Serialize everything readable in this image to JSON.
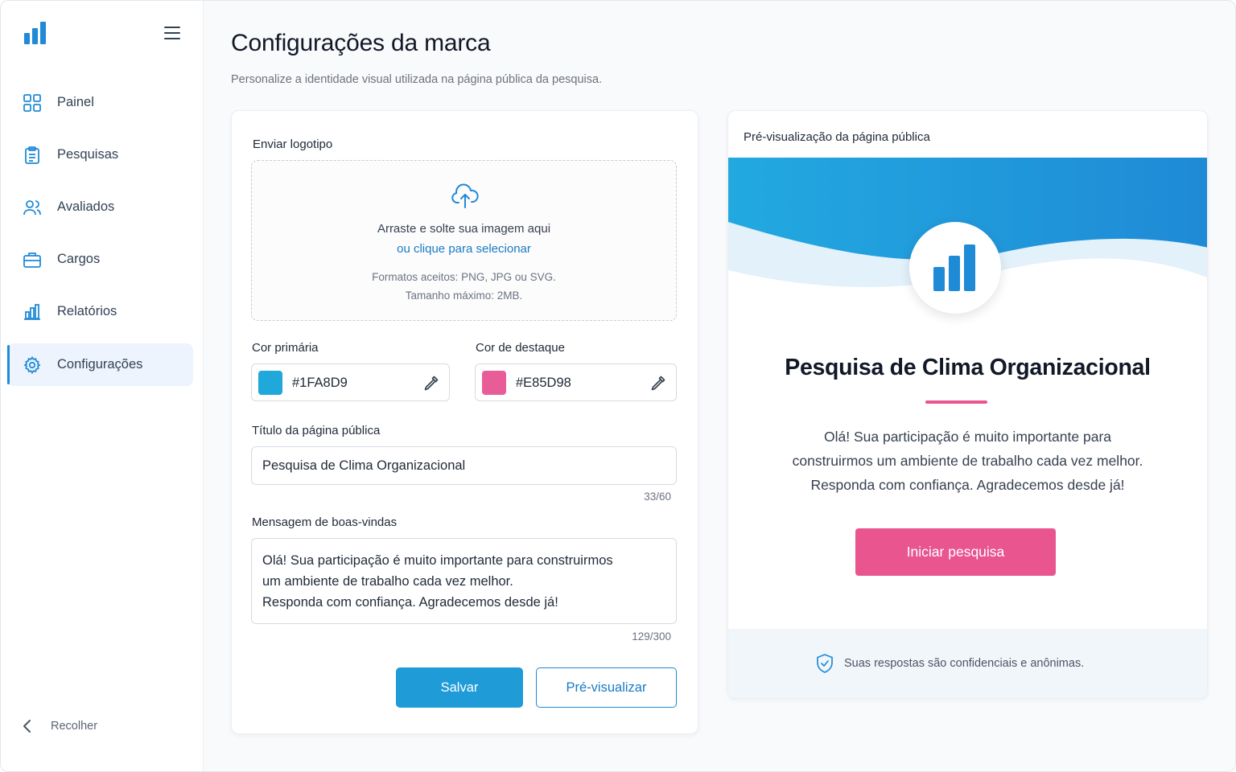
{
  "app": {
    "logo_icon": "bar-chart-logo",
    "menu_icon": "hamburger-icon"
  },
  "sidebar": {
    "items": [
      {
        "label": "Painel",
        "icon": "grid-icon",
        "active": false
      },
      {
        "label": "Pesquisas",
        "icon": "clipboard-icon",
        "active": false
      },
      {
        "label": "Avaliados",
        "icon": "users-icon",
        "active": false
      },
      {
        "label": "Cargos",
        "icon": "briefcase-icon",
        "active": false
      },
      {
        "label": "Relatórios",
        "icon": "bar-chart-icon",
        "active": false
      },
      {
        "label": "Configurações",
        "icon": "gear-icon",
        "active": true
      }
    ],
    "collapse_label": "Recolher"
  },
  "header": {
    "title": "Configurações da marca",
    "subtitle": "Personalize a identidade visual utilizada na página pública da pesquisa."
  },
  "form": {
    "logo_label": "Enviar logotipo",
    "dropzone": {
      "line1": "Arraste e solte sua imagem aqui",
      "link": "ou clique para selecionar",
      "formats": "Formatos aceitos: PNG, JPG ou SVG.",
      "max_size": "Tamanho máximo: 2MB."
    },
    "primary_color": {
      "label": "Cor primária",
      "value": "#1FA8D9",
      "swatch": "#1FA8D9"
    },
    "accent_color": {
      "label": "Cor de destaque",
      "value": "#E85D98",
      "swatch": "#E85D98"
    },
    "title_field": {
      "label": "Título da página pública",
      "value": "Pesquisa de Clima Organizacional",
      "counter": "33/60"
    },
    "message_field": {
      "label": "Mensagem de boas-vindas",
      "lines": [
        "Olá! Sua participação é muito importante para construirmos",
        "um ambiente de trabalho cada vez melhor.",
        "Responda com confiança. Agradecemos desde já!"
      ],
      "counter": "129/300"
    },
    "save_label": "Salvar",
    "preview_label": "Pré-visualizar"
  },
  "preview": {
    "label": "Pré-visualização da página pública",
    "title": "Pesquisa de Clima Organizacional",
    "message_lines": [
      "Olá! Sua participação é muito importante para",
      "construirmos um ambiente de trabalho cada vez melhor.",
      "Responda com confiança. Agradecemos desde já!"
    ],
    "start_button": "Iniciar pesquisa",
    "footer_text": "Suas respostas são confidenciais e anônimas.",
    "footer_icon": "shield-check-icon"
  },
  "colors": {
    "brand_blue": "#1f8ad6",
    "primary": "#1FA8D9",
    "accent": "#E85D98"
  }
}
